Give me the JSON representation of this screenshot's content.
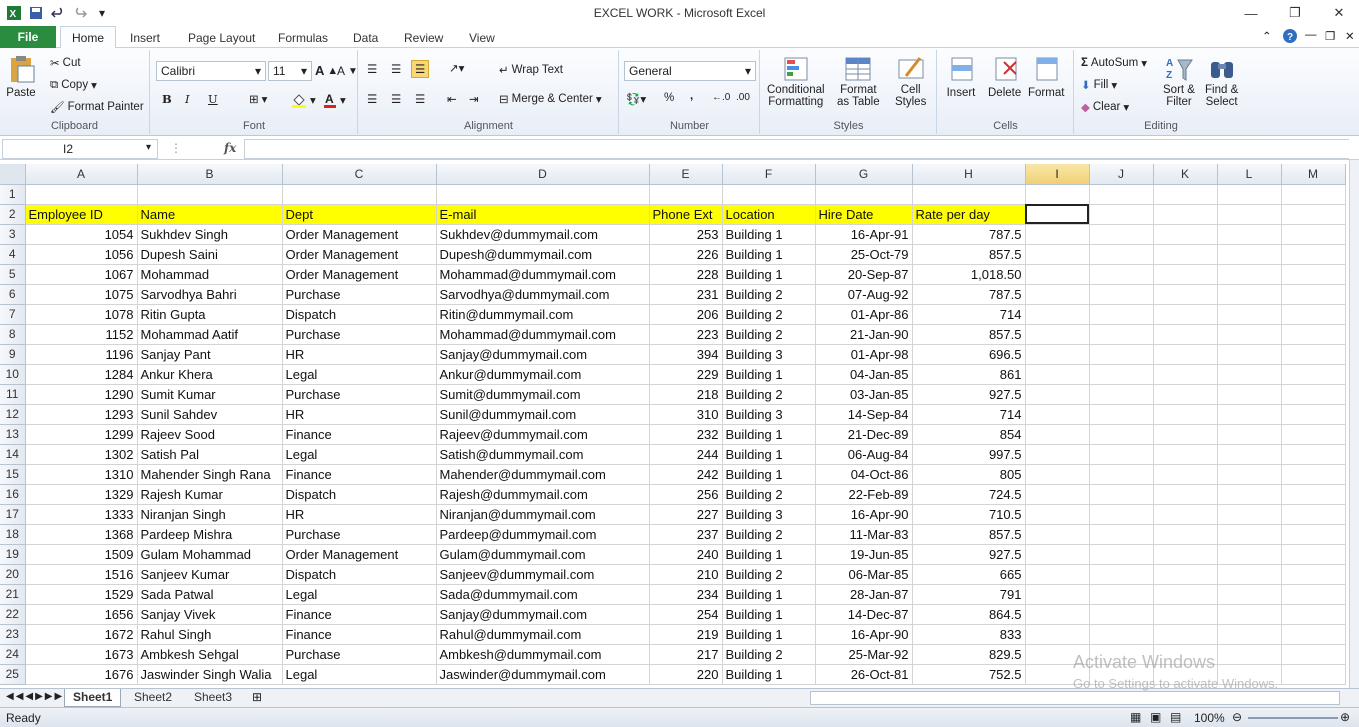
{
  "window": {
    "title": "EXCEL WORK  -  Microsoft Excel",
    "minimize_glyph": "—",
    "restore_glyph": "❐",
    "close_glyph": "✕"
  },
  "ribbon_tabs": {
    "file": "File",
    "home": "Home",
    "insert": "Insert",
    "page_layout": "Page Layout",
    "formulas": "Formulas",
    "data": "Data",
    "review": "Review",
    "view": "View"
  },
  "clipboard": {
    "paste": "Paste",
    "cut": "Cut",
    "copy": "Copy",
    "format_painter": "Format Painter",
    "label": "Clipboard"
  },
  "font": {
    "name": "Calibri",
    "size": "11",
    "bold": "B",
    "italic": "I",
    "underline": "U",
    "label": "Font"
  },
  "alignment": {
    "wrap_text": "Wrap Text",
    "merge_center": "Merge & Center",
    "label": "Alignment"
  },
  "number": {
    "format": "General",
    "percent": "%",
    "comma": ",",
    "label": "Number"
  },
  "styles": {
    "conditional": "Conditional",
    "formatting": "Formatting",
    "format_as": "Format",
    "as_table": "as Table",
    "cell": "Cell",
    "cell_styles": "Styles",
    "label": "Styles"
  },
  "cells": {
    "insert": "Insert",
    "delete": "Delete",
    "format": "Format",
    "label": "Cells"
  },
  "editing": {
    "autosum": "AutoSum",
    "fill": "Fill",
    "clear": "Clear",
    "sort": "Sort &",
    "filter": "Filter",
    "find": "Find &",
    "select": "Select",
    "label": "Editing"
  },
  "formula_bar": {
    "name_box": "I2",
    "fx": "fx",
    "value": ""
  },
  "grid": {
    "columns": [
      "A",
      "B",
      "C",
      "D",
      "E",
      "F",
      "G",
      "H",
      "I",
      "J",
      "K",
      "L",
      "M"
    ],
    "selected_column": "I",
    "header_row": [
      "Employee ID",
      "Name",
      "Dept",
      "E-mail",
      "Phone Ext",
      "Location",
      "Hire Date",
      "Rate per day"
    ],
    "rows": [
      [
        "1054",
        "Sukhdev Singh",
        "Order Management",
        "Sukhdev@dummymail.com",
        "253",
        "Building 1",
        "16-Apr-91",
        "787.5"
      ],
      [
        "1056",
        "Dupesh Saini",
        "Order Management",
        "Dupesh@dummymail.com",
        "226",
        "Building 1",
        "25-Oct-79",
        "857.5"
      ],
      [
        "1067",
        "Mohammad",
        "Order Management",
        "Mohammad@dummymail.com",
        "228",
        "Building 1",
        "20-Sep-87",
        "1,018.50"
      ],
      [
        "1075",
        "Sarvodhya Bahri",
        "Purchase",
        "Sarvodhya@dummymail.com",
        "231",
        "Building 2",
        "07-Aug-92",
        "787.5"
      ],
      [
        "1078",
        "Ritin Gupta",
        "Dispatch",
        "Ritin@dummymail.com",
        "206",
        "Building 2",
        "01-Apr-86",
        "714"
      ],
      [
        "1152",
        "Mohammad Aatif",
        "Purchase",
        "Mohammad@dummymail.com",
        "223",
        "Building 2",
        "21-Jan-90",
        "857.5"
      ],
      [
        "1196",
        "Sanjay Pant",
        "HR",
        "Sanjay@dummymail.com",
        "394",
        "Building 3",
        "01-Apr-98",
        "696.5"
      ],
      [
        "1284",
        "Ankur Khera",
        "Legal",
        "Ankur@dummymail.com",
        "229",
        "Building 1",
        "04-Jan-85",
        "861"
      ],
      [
        "1290",
        "Sumit Kumar",
        "Purchase",
        "Sumit@dummymail.com",
        "218",
        "Building 2",
        "03-Jan-85",
        "927.5"
      ],
      [
        "1293",
        "Sunil Sahdev",
        "HR",
        "Sunil@dummymail.com",
        "310",
        "Building 3",
        "14-Sep-84",
        "714"
      ],
      [
        "1299",
        "Rajeev Sood",
        "Finance",
        "Rajeev@dummymail.com",
        "232",
        "Building 1",
        "21-Dec-89",
        "854"
      ],
      [
        "1302",
        "Satish Pal",
        "Legal",
        "Satish@dummymail.com",
        "244",
        "Building 1",
        "06-Aug-84",
        "997.5"
      ],
      [
        "1310",
        "Mahender Singh Rana",
        "Finance",
        "Mahender@dummymail.com",
        "242",
        "Building 1",
        "04-Oct-86",
        "805"
      ],
      [
        "1329",
        "Rajesh Kumar",
        "Dispatch",
        "Rajesh@dummymail.com",
        "256",
        "Building 2",
        "22-Feb-89",
        "724.5"
      ],
      [
        "1333",
        "Niranjan Singh",
        "HR",
        "Niranjan@dummymail.com",
        "227",
        "Building 3",
        "16-Apr-90",
        "710.5"
      ],
      [
        "1368",
        "Pardeep Mishra",
        "Purchase",
        "Pardeep@dummymail.com",
        "237",
        "Building 2",
        "11-Mar-83",
        "857.5"
      ],
      [
        "1509",
        "Gulam Mohammad",
        "Order Management",
        "Gulam@dummymail.com",
        "240",
        "Building 1",
        "19-Jun-85",
        "927.5"
      ],
      [
        "1516",
        "Sanjeev Kumar",
        "Dispatch",
        "Sanjeev@dummymail.com",
        "210",
        "Building 2",
        "06-Mar-85",
        "665"
      ],
      [
        "1529",
        "Sada Patwal",
        "Legal",
        "Sada@dummymail.com",
        "234",
        "Building 1",
        "28-Jan-87",
        "791"
      ],
      [
        "1656",
        "Sanjay Vivek",
        "Finance",
        "Sanjay@dummymail.com",
        "254",
        "Building 1",
        "14-Dec-87",
        "864.5"
      ],
      [
        "1672",
        "Rahul Singh",
        "Finance",
        "Rahul@dummymail.com",
        "219",
        "Building 1",
        "16-Apr-90",
        "833"
      ],
      [
        "1673",
        "Ambkesh Sehgal",
        "Purchase",
        "Ambkesh@dummymail.com",
        "217",
        "Building 2",
        "25-Mar-92",
        "829.5"
      ],
      [
        "1676",
        "Jaswinder Singh Walia",
        "Legal",
        "Jaswinder@dummymail.com",
        "220",
        "Building 1",
        "26-Oct-81",
        "752.5"
      ]
    ]
  },
  "sheets": {
    "tab1": "Sheet1",
    "tab2": "Sheet2",
    "tab3": "Sheet3"
  },
  "status": {
    "ready": "Ready",
    "zoom": "100%"
  },
  "watermark": {
    "line1": "Activate Windows",
    "line2": "Go to Settings to activate Windows."
  },
  "colors": {
    "file_tab": "#2a8c3e",
    "header_fill": "#ffff00",
    "selected_header": "#f1d075"
  }
}
